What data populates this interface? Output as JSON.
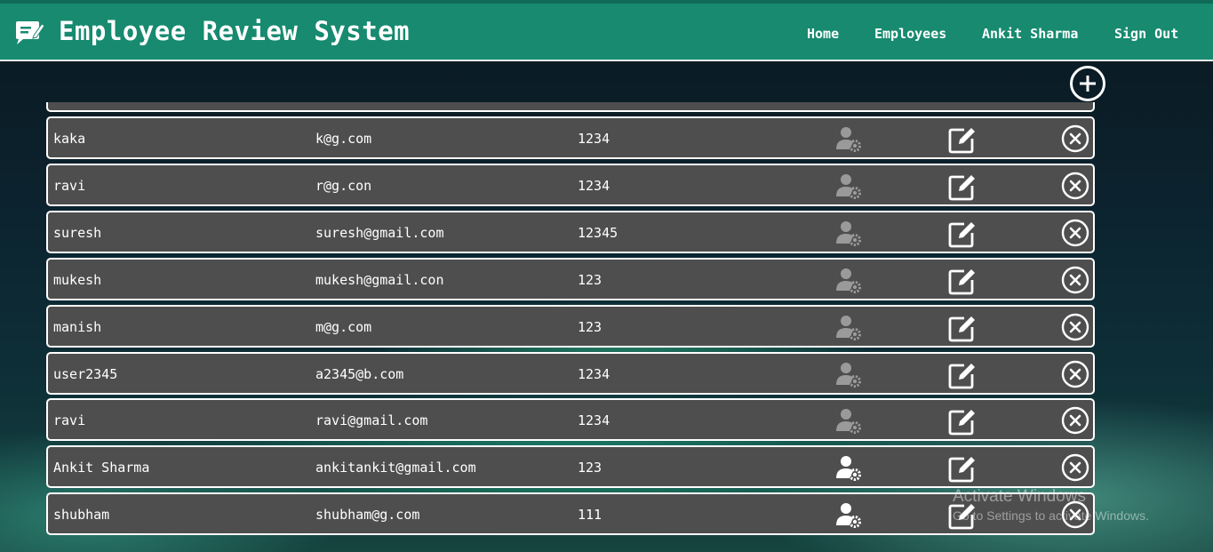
{
  "app": {
    "title": "Employee Review System"
  },
  "nav": {
    "home": "Home",
    "employees": "Employees",
    "user": "Ankit Sharma",
    "sign_out": "Sign Out"
  },
  "toolbar": {
    "add_icon": "plus-circle-icon"
  },
  "employees": [
    {
      "name": "kaka",
      "email": "k@g.com",
      "password": "1234",
      "is_admin": false
    },
    {
      "name": "ravi",
      "email": "r@g.con",
      "password": "1234",
      "is_admin": false
    },
    {
      "name": "suresh",
      "email": "suresh@gmail.com",
      "password": "12345",
      "is_admin": false
    },
    {
      "name": "mukesh",
      "email": "mukesh@gmail.con",
      "password": "123",
      "is_admin": false
    },
    {
      "name": "manish",
      "email": "m@g.com",
      "password": "123",
      "is_admin": false
    },
    {
      "name": "user2345",
      "email": "a2345@b.com",
      "password": "1234",
      "is_admin": false
    },
    {
      "name": "ravi",
      "email": "ravi@gmail.com",
      "password": "1234",
      "is_admin": false
    },
    {
      "name": "Ankit Sharma",
      "email": "ankitankit@gmail.com",
      "password": "123",
      "is_admin": true
    },
    {
      "name": "shubham",
      "email": "shubham@g.com",
      "password": "111",
      "is_admin": true
    }
  ],
  "row_icons": {
    "role": "user-gear-icon",
    "edit": "edit-icon",
    "delete": "close-circle-icon"
  },
  "watermark": {
    "line1": "Activate Windows",
    "line2": "Go to Settings to activate Windows."
  },
  "colors": {
    "header": "#178a70",
    "row_bg": "#4e4e4e",
    "admin_icon": "#ffffff",
    "non_admin_icon": "#9a9a9a"
  }
}
